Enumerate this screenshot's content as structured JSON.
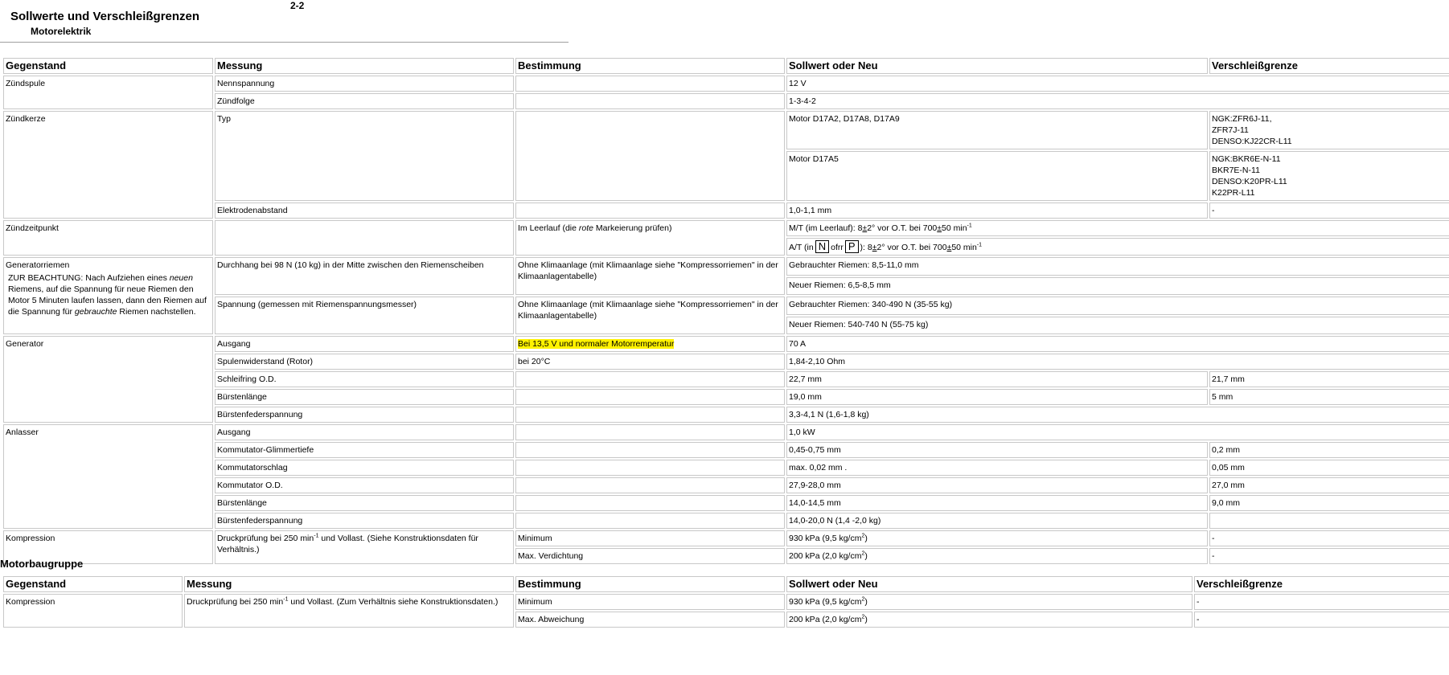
{
  "header": {
    "title": "Sollwerte und Verschleißgrenzen",
    "subtitle": "Motorelektrik",
    "page": "2-2"
  },
  "columns": [
    "Gegenstand",
    "Messung",
    "Bestimmung",
    "Sollwert oder Neu",
    "Verschleißgrenze"
  ],
  "rows": {
    "zuendspule": "Zündspule",
    "nennspannung": "Nennspannung",
    "nennspannung_soll": "12 V",
    "zuendfolge": "Zündfolge",
    "zuendfolge_soll": "1-3-4-2",
    "zuendkerze": "Zündkerze",
    "typ": "Typ",
    "motor1": "Motor D17A2, D17A8, D17A9",
    "motor1_vg": [
      "NGK:ZFR6J-11,",
      "ZFR7J-11",
      "DENSO:KJ22CR-L11"
    ],
    "motor2": "Motor D17A5",
    "motor2_vg": [
      "NGK:BKR6E-N-11",
      "BKR7E-N-11",
      "DENSO:K20PR-L11",
      "K22PR-L11"
    ],
    "elektrodenabstand": "Elektrodenabstand",
    "elektrodenabstand_soll": "1,0-1,1 mm",
    "elektrodenabstand_vg": "-",
    "zuendzeitpunkt": "Zündzeitpunkt",
    "zzp_best_a": "Im Leerlauf (die",
    "zzp_best_em": "rote",
    "zzp_best_b": "Markeierung prüfen)",
    "mt_a": "M/T (im Leerlauf): 8",
    "mt_pm1": "±",
    "mt_b": "2° vor O.T. bei 700",
    "mt_pm2": "±",
    "mt_c": "50 min",
    "mt_sup": "-1",
    "at_a": "A/T (in",
    "at_box_n": "N",
    "at_mid": "ofrr",
    "at_box_p": "P",
    "at_b": "): 8",
    "at_pm1": "±",
    "at_c": "2° vor O.T. bei 700",
    "at_pm2": "±",
    "at_d": "50 min",
    "at_sup": "-1",
    "generatorriemen": "Generatorriemen",
    "note_a": "ZUR BEACHTUNG: Nach Aufziehen eines",
    "note_em1": "neuen",
    "note_b": "Riemens, auf die Spannung für neue Riemen den Motor 5 Minuten laufen lassen, dann den Riemen auf die Spannung für",
    "note_em2": "gebrauchte",
    "note_c": "Riemen nachstellen.",
    "durchhang": "Durchhang bei 98 N (10 kg) in der Mitte zwischen den Riemenscheiben",
    "ohne_klima": "Ohne Klimaanlage (mit Klimaanlage siehe \"Kompressorriemen\" in der Klimaanlagentabelle)",
    "gebr_riemen_1": "Gebrauchter Riemen: 8,5-11,0 mm",
    "neu_riemen_1": "Neuer Riemen: 6,5-8,5 mm",
    "spannung": "Spannung (gemessen mit Riemenspannungsmesser)",
    "gebr_riemen_2": "Gebrauchter Riemen: 340-490 N (35-55 kg)",
    "neu_riemen_2": "Neuer Riemen: 540-740 N (55-75 kg)",
    "generator": "Generator",
    "ausgang": "Ausgang",
    "ausgang_best": "Bei 13,5 V und normaler Motorremperatur",
    "ausgang_soll": "70 A",
    "spulenwiderstand": "Spulenwiderstand (Rotor)",
    "spulenwiderstand_best": "bei 20°C",
    "spulenwiderstand_soll": "1,84-2,10 Ohm",
    "schleifring": "Schleifring O.D.",
    "schleifring_soll": "22,7 mm",
    "schleifring_vg": "21,7 mm",
    "buerstenlaenge": "Bürstenlänge",
    "buerstenlaenge_soll": "19,0 mm",
    "buerstenlaenge_vg": "5 mm",
    "buerstenfederspannung": "Bürstenfederspannung",
    "buerstenfederspannung_soll": "3,3-4,1 N (1,6-1,8 kg)",
    "anlasser": "Anlasser",
    "an_ausgang": "Ausgang",
    "an_ausgang_soll": "1,0 kW",
    "glimmertiefe": "Kommutator-Glimmertiefe",
    "glimmertiefe_soll": "0,45-0,75 mm",
    "glimmertiefe_vg": "0,2 mm",
    "kommutatorschlag": "Kommutatorschlag",
    "kommutatorschlag_soll": "max. 0,02 mm .",
    "kommutatorschlag_vg": "0,05 mm",
    "kommutator_od": "Kommutator O.D.",
    "kommutator_od_soll": "27,9-28,0 mm",
    "kommutator_od_vg": "27,0 mm",
    "an_buerstenlaenge": "Bürstenlänge",
    "an_buerstenlaenge_soll": "14,0-14,5 mm",
    "an_buerstenlaenge_vg": "9,0 mm",
    "an_buerstenfederspannung": "Bürstenfederspannung",
    "an_buerstenfederspannung_soll": "14,0-20,0 N (1,4 -2,0 kg)",
    "kompression": "Kompression",
    "druck_a": "Druckprüfung bei 250 min",
    "druck_sup": "-1",
    "druck_b": "und Vollast. (Siehe Konstruktionsdaten für Verhältnis.)",
    "minimum": "Minimum",
    "min_soll_a": "930 kPa (9,5 kg/cm",
    "min_soll_sup": "2",
    "min_soll_b": ")",
    "min_vg": "-",
    "max_verdichtung": "Max. Verdichtung",
    "max_soll_a": "200 kPa (2,0 kg/cm",
    "max_soll_sup": "2",
    "max_soll_b": ")",
    "max_vg": "-"
  },
  "section2": {
    "title": "Motorbaugruppe",
    "kompression": "Kompression",
    "druck_a": "Druckprüfung bei 250 min",
    "druck_sup": "-1",
    "druck_b": "und Vollast. (Zum Verhältnis siehe Konstruktionsdaten.)",
    "minimum": "Minimum",
    "min_soll_a": "930 kPa (9,5 kg/cm",
    "min_soll_sup": "2",
    "min_soll_b": ")",
    "min_vg": "-",
    "max_abweichung": "Max. Abweichung",
    "max_soll_a": "200 kPa (2,0 kg/cm",
    "max_soll_sup": "2",
    "max_soll_b": ")",
    "max_vg": "-"
  }
}
